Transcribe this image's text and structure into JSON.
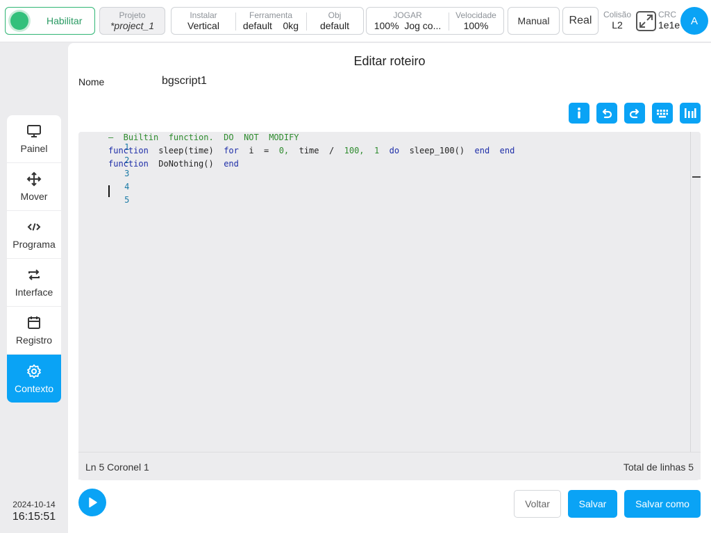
{
  "header": {
    "enable_label": "Habilitar",
    "project": {
      "caption": "Projeto",
      "value": "*project_1"
    },
    "install": {
      "caption": "Instalar",
      "value": "Vertical"
    },
    "tool": {
      "caption": "Ferramenta",
      "value": "default",
      "weight": "0kg"
    },
    "obj": {
      "caption": "Obj",
      "value": "default"
    },
    "jog": {
      "caption": "JOGAR",
      "percent": "100%",
      "mode": "Jog co..."
    },
    "speed": {
      "caption": "Velocidade",
      "value": "100%"
    },
    "manual_label": "Manual",
    "real_label": "Real",
    "collision": {
      "caption": "Colisão",
      "value": "L2"
    },
    "crc": {
      "caption": "CRC",
      "value": "1e1e"
    },
    "avatar_letter": "A"
  },
  "sidebar": {
    "items": [
      {
        "label": "Painel",
        "icon": "monitor-icon"
      },
      {
        "label": "Mover",
        "icon": "move-arrows-icon"
      },
      {
        "label": "Programa",
        "icon": "code-icon"
      },
      {
        "label": "Interface",
        "icon": "swap-arrows-icon"
      },
      {
        "label": "Registro",
        "icon": "calendar-icon"
      },
      {
        "label": "Contexto",
        "icon": "gear-icon",
        "active": true
      }
    ],
    "date": "2024-10-14",
    "time": "16:15:51"
  },
  "editor": {
    "title": "Editar roteiro",
    "name_label": "Nome",
    "name_value": "bgscript1",
    "toolbar_icons": [
      "info-icon",
      "undo-icon",
      "redo-icon",
      "keyboard-icon",
      "columns-icon"
    ],
    "line_numbers": [
      "1",
      "2",
      "3",
      "4",
      "5"
    ],
    "lines": {
      "l1": "—  Builtin  function.  DO  NOT  MODIFY",
      "l2": {
        "kw_function": "function",
        "sig": "sleep(time)",
        "kw_for": "for",
        "i_eq": "i  =",
        "zero": "0,",
        "time_div": "time  /",
        "hundred": "100,",
        "one": "1",
        "kw_do": "do",
        "call": "sleep_100()",
        "kw_end1": "end",
        "kw_end2": "end"
      },
      "l3": {
        "kw_function": "function",
        "sig": "DoNothing()",
        "kw_end": "end"
      }
    },
    "status_left": "Ln 5 Coronel 1",
    "status_right": "Total de linhas 5"
  },
  "actions": {
    "back_label": "Voltar",
    "save_label": "Salvar",
    "save_as_label": "Salvar como"
  },
  "colors": {
    "accent": "#0aa3f5",
    "enable_green": "#33c07b"
  }
}
